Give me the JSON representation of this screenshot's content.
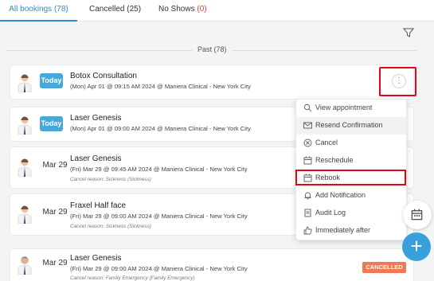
{
  "tabs": {
    "all_bookings": "All bookings (78)",
    "cancelled": "Cancelled (25)",
    "no_shows_label": "No Shows",
    "no_shows_count": "(0)"
  },
  "past_label": "Past (78)",
  "bookings": [
    {
      "badge": "Today",
      "title": "Botox Consultation",
      "detail": "(Mon) Apr 01 @ 09:15 AM 2024 @ Maniera Clinical - New York City",
      "reason": ""
    },
    {
      "badge": "Today",
      "title": "Laser Genesis",
      "detail": "(Mon) Apr 01 @ 09:00 AM 2024 @ Maniera Clinical - New York City",
      "reason": ""
    },
    {
      "badge": "Mar 29",
      "title": "Laser Genesis",
      "detail": "(Fri) Mar 29 @ 09:45 AM 2024 @ Maniera Clinical - New York City",
      "reason": "Cancel reason: Sickness (Sickness)"
    },
    {
      "badge": "Mar 29",
      "title": "Fraxel Half face",
      "detail": "(Fri) Mar 29 @ 09:00 AM 2024 @ Maniera Clinical - New York City",
      "reason": "Cancel reason: Sickness (Sickness)"
    },
    {
      "badge": "Mar 29",
      "title": "Laser Genesis",
      "detail": "(Fri) Mar 29 @ 09:00 AM 2024 @ Maniera Clinical - New York City",
      "reason": "Cancel reason: Family Emergency (Family Emergency)",
      "status": "CANCELLED"
    }
  ],
  "menu": {
    "view": "View appointment",
    "resend": "Resend Confirmation",
    "cancel": "Cancel",
    "reschedule": "Reschedule",
    "rebook": "Rebook",
    "add_notification": "Add Notification",
    "audit_log": "Audit Log",
    "immediately_after": "Immediately after"
  },
  "more_glyph": "⋮",
  "add_glyph": "+",
  "colors": {
    "accent": "#2a8fd1",
    "today_badge": "#4aa8d8",
    "cancelled_badge": "#f07855",
    "highlight_border": "#e30613",
    "no_show_count": "#e53935"
  },
  "icons": [
    "filter-icon",
    "more-vertical-icon",
    "search-icon",
    "mail-icon",
    "cancel-circle-icon",
    "calendar-icon",
    "bell-icon",
    "document-icon",
    "thumbs-up-icon",
    "plus-icon"
  ]
}
